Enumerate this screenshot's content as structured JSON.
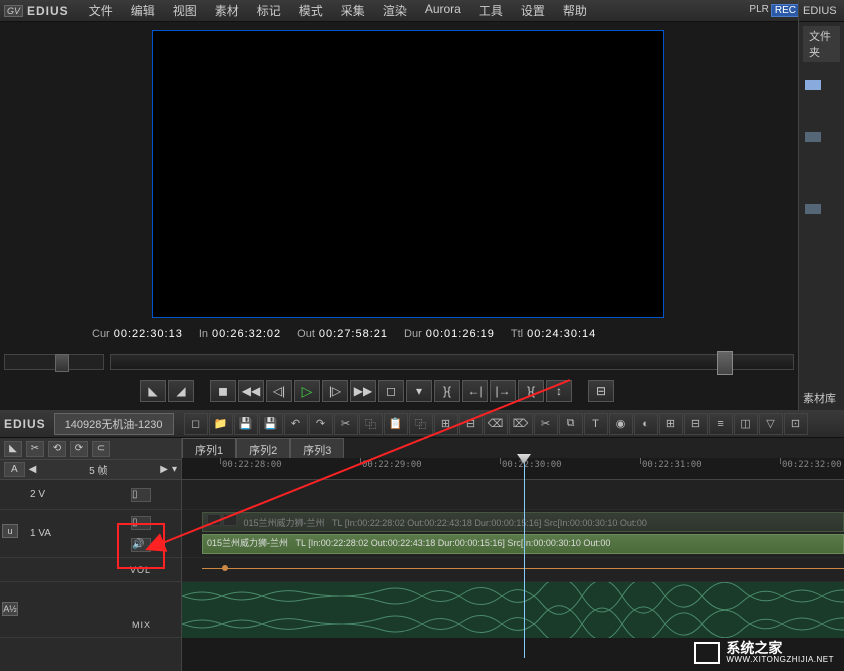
{
  "app": {
    "logo_badge": "GV",
    "name": "EDIUS"
  },
  "menu": [
    "文件",
    "编辑",
    "视图",
    "素材",
    "标记",
    "模式",
    "采集",
    "渲染",
    "Aurora",
    "工具",
    "设置",
    "帮助"
  ],
  "top_right": {
    "plr": "PLR",
    "rec": "REC"
  },
  "right_panel": {
    "title": "EDIUS",
    "tab": "文件夹",
    "bottom": "素材库"
  },
  "timecodes": {
    "cur_label": "Cur",
    "cur": "00:22:30:13",
    "in_label": "In",
    "in": "00:26:32:02",
    "out_label": "Out",
    "out": "00:27:58:21",
    "dur_label": "Dur",
    "dur": "00:01:26:19",
    "ttl_label": "Ttl",
    "ttl": "00:24:30:14"
  },
  "timeline": {
    "title": "EDIUS",
    "sequence_tab": "140928无机油-1230",
    "seq_tabs": [
      "序列1",
      "序列2",
      "序列3"
    ],
    "frame_label": "5 帧",
    "a_badge": "A",
    "u_badge": "u",
    "a12_badge": "A½"
  },
  "ruler": [
    "00:22:28:00",
    "00:22:29:00",
    "00:22:30:00",
    "00:22:31:00",
    "00:22:32:00"
  ],
  "tracks": {
    "v2": "2 V",
    "va1": "1 VA",
    "vol": "VOL",
    "mix": "MIX"
  },
  "clips": {
    "dim_name": "015兰州威力狮-兰州",
    "dim_tl": "TL [In:00:22:28:02 Out:00:22:43:18 Dur:00:00:15:16]  Src[In:00:00:30:10 Out:00",
    "main_name": "015兰州威力狮-兰州",
    "main_tl": "TL [In:00:22:28:02 Out:00:22:43:18 Dur:00:00:15:16]  Src[In:00:00:30:10 Out:00"
  },
  "watermark": {
    "cn": "系统之家",
    "en": "WWW.XITONGZHIJIA.NET"
  }
}
